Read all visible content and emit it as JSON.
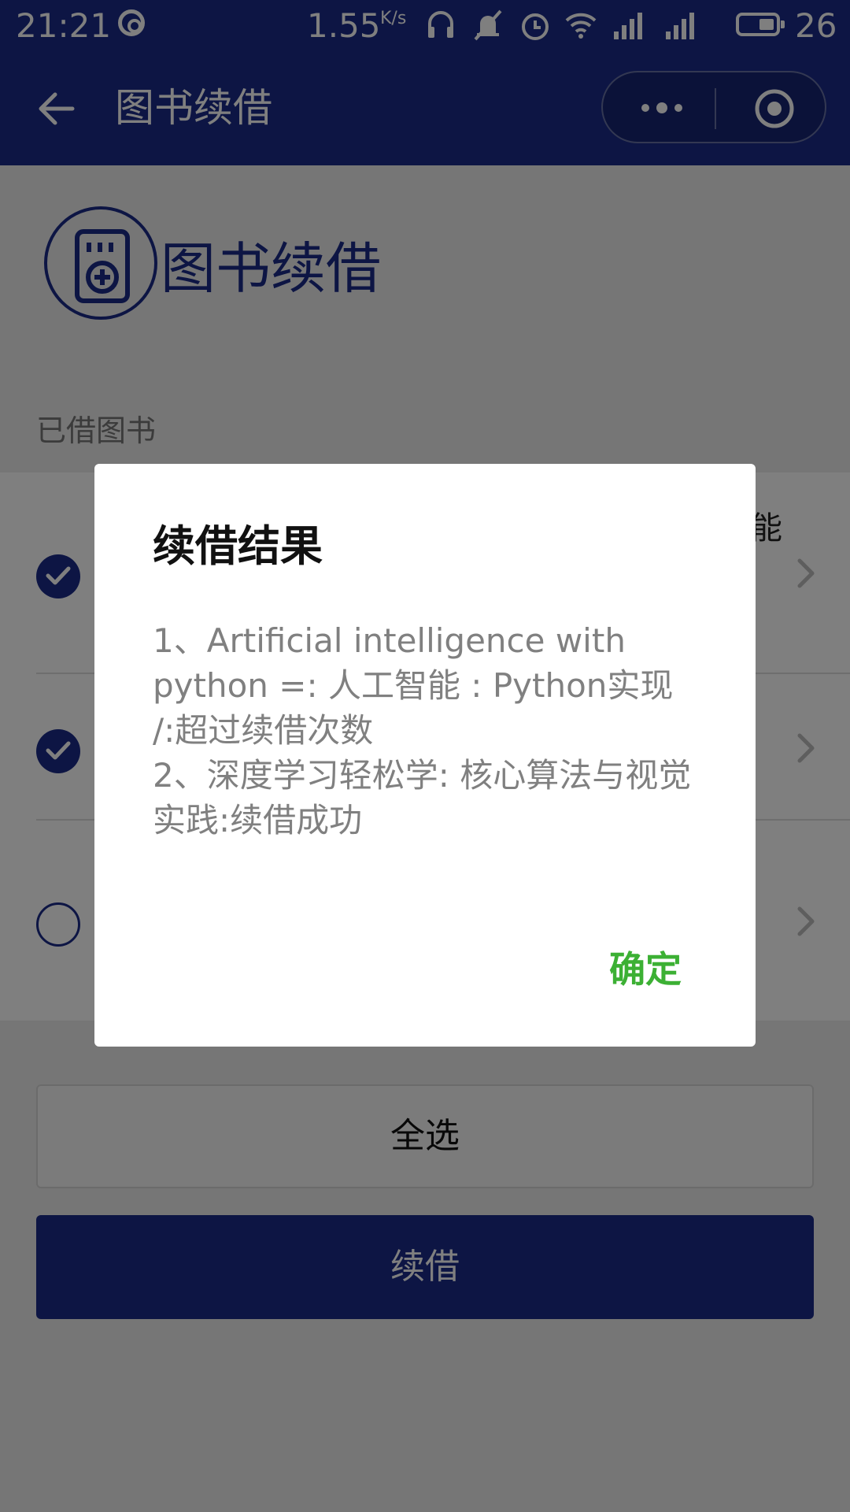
{
  "status_bar": {
    "time": "21:21",
    "network_speed": "1.55",
    "network_speed_unit": "K/s",
    "battery": "26"
  },
  "nav": {
    "title": "图书续借"
  },
  "header": {
    "title": "图书续借"
  },
  "section": {
    "label": "已借图书"
  },
  "books": [
    {
      "checked": true,
      "title_visible_fragment": "能"
    },
    {
      "checked": true
    },
    {
      "checked": false
    }
  ],
  "buttons": {
    "select_all": "全选",
    "renew": "续借"
  },
  "dialog": {
    "title": "续借结果",
    "lines": [
      "1、Artificial intelligence with python =: 人工智能 : Python实现 /:超过续借次数",
      "2、深度学习轻松学: 核心算法与视觉实践:续借成功"
    ],
    "confirm": "确定"
  },
  "colors": {
    "primary": "#1a2b88",
    "confirm_green": "#3cb034"
  }
}
